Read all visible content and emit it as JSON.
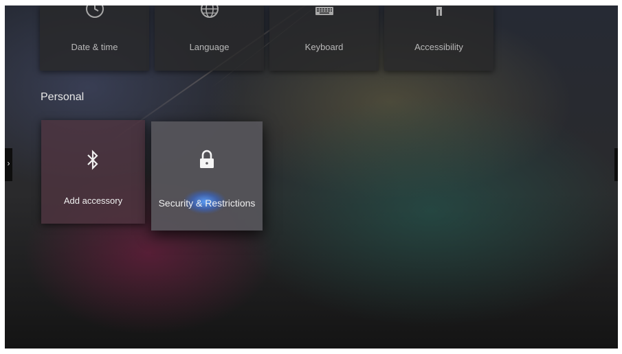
{
  "settings": {
    "top_tiles": [
      {
        "label": "Date & time",
        "icon": "clock-icon"
      },
      {
        "label": "Language",
        "icon": "globe-icon"
      },
      {
        "label": "Keyboard",
        "icon": "keyboard-icon"
      },
      {
        "label": "Accessibility",
        "icon": "accessibility-icon"
      }
    ],
    "personal": {
      "title": "Personal",
      "tiles": [
        {
          "label": "Add accessory",
          "icon": "bluetooth-icon"
        },
        {
          "label": "Security & Restrictions",
          "icon": "lock-icon",
          "focused": true
        }
      ]
    }
  },
  "nav": {
    "left_arrow": "›"
  },
  "colors": {
    "focus_glow": "#3c82ff",
    "tile_background": "#2a2a2c"
  }
}
